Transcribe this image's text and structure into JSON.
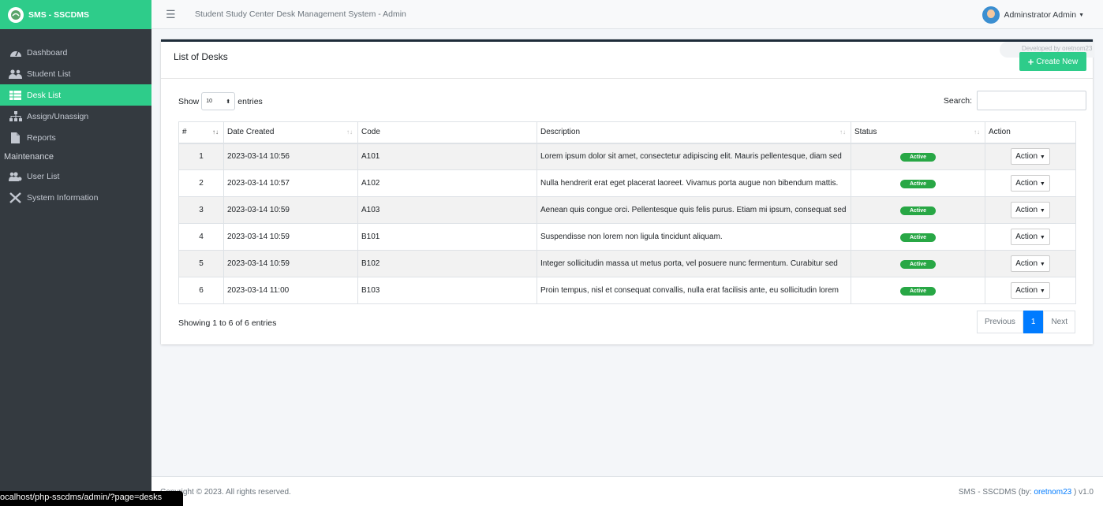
{
  "brand": {
    "title": "SMS - SSCDMS"
  },
  "sidebar": {
    "items": [
      {
        "label": "Dashboard",
        "icon": "tachometer-icon"
      },
      {
        "label": "Student List",
        "icon": "users-icon"
      },
      {
        "label": "Desk List",
        "icon": "table-icon",
        "active": true
      },
      {
        "label": "Assign/Unassign",
        "icon": "sitemap-icon"
      },
      {
        "label": "Reports",
        "icon": "file-icon"
      }
    ],
    "maintenance_header": "Maintenance",
    "maintenance_items": [
      {
        "label": "User List",
        "icon": "users-cog-icon"
      },
      {
        "label": "System Information",
        "icon": "tools-icon"
      }
    ]
  },
  "topbar": {
    "title": "Student Study Center Desk Management System - Admin",
    "user": "Adminstrator Admin"
  },
  "card": {
    "title": "List of Desks",
    "developed_by": "Developed by oretnom23",
    "create_label": "Create New"
  },
  "controls": {
    "show_label": "Show",
    "entries_value": "10",
    "entries_label": "entries",
    "search_label": "Search:",
    "search_value": ""
  },
  "table": {
    "headers": [
      "#",
      "Date Created",
      "Code",
      "Description",
      "Status",
      "Action"
    ],
    "rows": [
      {
        "num": "1",
        "date": "2023-03-14 10:56",
        "code": "A101",
        "desc": "Lorem ipsum dolor sit amet, consectetur adipiscing elit. Mauris pellentesque, diam sed",
        "status": "Active",
        "action": "Action"
      },
      {
        "num": "2",
        "date": "2023-03-14 10:57",
        "code": "A102",
        "desc": "Nulla hendrerit erat eget placerat laoreet. Vivamus porta augue non bibendum mattis.",
        "status": "Active",
        "action": "Action"
      },
      {
        "num": "3",
        "date": "2023-03-14 10:59",
        "code": "A103",
        "desc": "Aenean quis congue orci. Pellentesque quis felis purus. Etiam mi ipsum, consequat sed",
        "status": "Active",
        "action": "Action"
      },
      {
        "num": "4",
        "date": "2023-03-14 10:59",
        "code": "B101",
        "desc": "Suspendisse non lorem non ligula tincidunt aliquam.",
        "status": "Active",
        "action": "Action"
      },
      {
        "num": "5",
        "date": "2023-03-14 10:59",
        "code": "B102",
        "desc": "Integer sollicitudin massa ut metus porta, vel posuere nunc fermentum. Curabitur sed",
        "status": "Active",
        "action": "Action"
      },
      {
        "num": "6",
        "date": "2023-03-14 11:00",
        "code": "B103",
        "desc": "Proin tempus, nisl et consequat convallis, nulla erat facilisis ante, eu sollicitudin lorem",
        "status": "Active",
        "action": "Action"
      }
    ]
  },
  "pagination": {
    "info": "Showing 1 to 6 of 6 entries",
    "previous": "Previous",
    "current": "1",
    "next": "Next"
  },
  "footer": {
    "copyright": "Copyright © 2023. All rights reserved.",
    "app": "SMS - SSCDMS (by: ",
    "author": "oretnom23",
    "version": " ) v1.0"
  },
  "statusbar": {
    "url": "ocalhost/php-sscdms/admin/?page=desks"
  },
  "colors": {
    "accent": "#2ecc8a",
    "sidebar": "#343a40",
    "primary": "#007bff",
    "success": "#28a745"
  }
}
